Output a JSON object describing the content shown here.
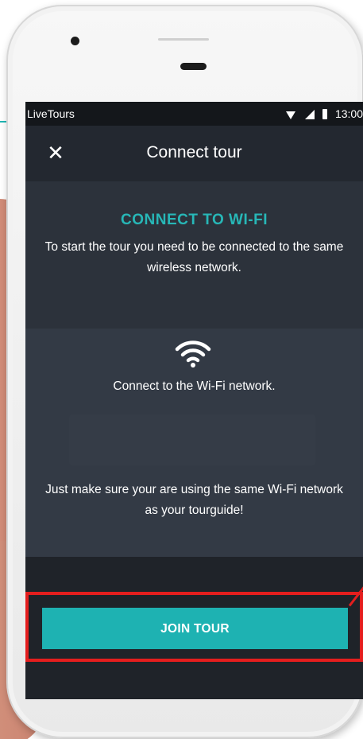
{
  "status_bar": {
    "app_name": "LiveTours",
    "time": "13:00"
  },
  "app_bar": {
    "close_icon": "✕",
    "title": "Connect tour"
  },
  "intro": {
    "heading": "CONNECT TO WI-FI",
    "text": "To start the tour you need to be connected to the same wireless network."
  },
  "wifi": {
    "icon": "wifi-icon",
    "label": "Connect to the Wi-Fi network.",
    "note": "Just make sure your are using the same Wi-Fi network as your tourguide!"
  },
  "actions": {
    "join_label": "JOIN TOUR"
  },
  "colors": {
    "accent": "#1eb2b2",
    "highlight": "#e41e1e"
  }
}
